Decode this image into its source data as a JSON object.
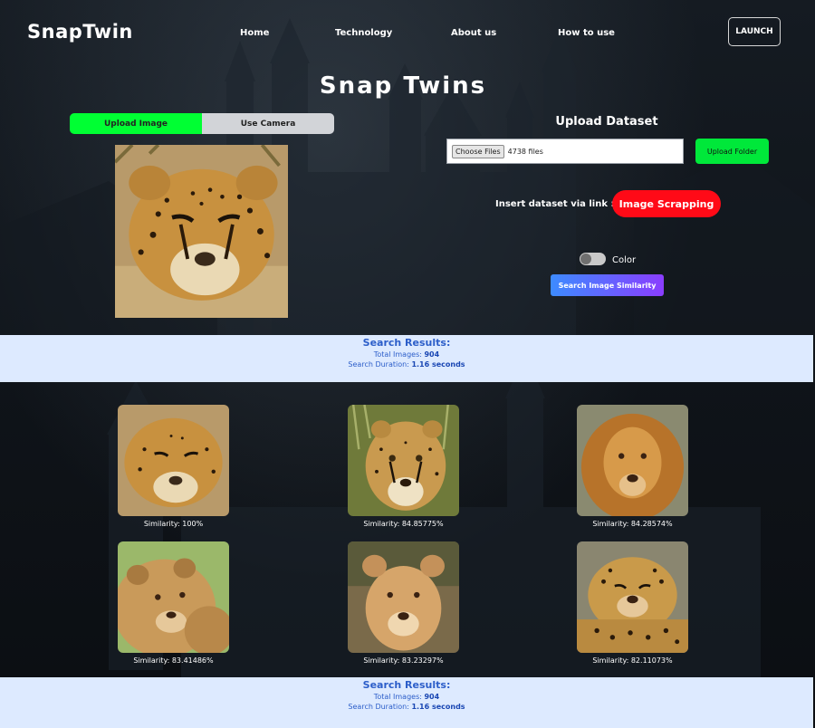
{
  "app": {
    "brand": "SnapTwin",
    "hero_title": "Snap Twins"
  },
  "nav": {
    "links": [
      "Home",
      "Technology",
      "About us",
      "How to use"
    ],
    "launch_label": "LAUNCH"
  },
  "upload_tabs": {
    "upload_image": "Upload Image",
    "use_camera": "Use Camera",
    "active": "Upload Image"
  },
  "query_image": {
    "subject": "cheetah",
    "icon": "query-image"
  },
  "dataset": {
    "title": "Upload Dataset",
    "choose_label": "Choose Files",
    "file_count": "4738 files",
    "upload_folder_label": "Upload Folder",
    "insert_label": "Insert dataset via link :",
    "scrap_label": "Image Scrapping"
  },
  "color_toggle": {
    "label": "Color",
    "on": false
  },
  "search_button_label": "Search Image Similarity",
  "results": {
    "title": "Search Results:",
    "total_label": "Total Images: ",
    "total_value": "904",
    "duration_label": "Search Duration: ",
    "duration_value": "1.16 seconds",
    "items": [
      {
        "subject": "cheetah",
        "label": "Similarity: 100%"
      },
      {
        "subject": "cheetah",
        "label": "Similarity: 84.85775%"
      },
      {
        "subject": "lion",
        "label": "Similarity: 84.28574%"
      },
      {
        "subject": "lion cub",
        "label": "Similarity: 83.41486%"
      },
      {
        "subject": "lion cub",
        "label": "Similarity: 83.23297%"
      },
      {
        "subject": "leopard",
        "label": "Similarity: 82.11073%"
      }
    ]
  },
  "colors": {
    "active_tab": "#00ff33",
    "scrap_button": "#ff0a17",
    "results_bar": "#ddeaff",
    "results_text": "#2c5ec9"
  }
}
